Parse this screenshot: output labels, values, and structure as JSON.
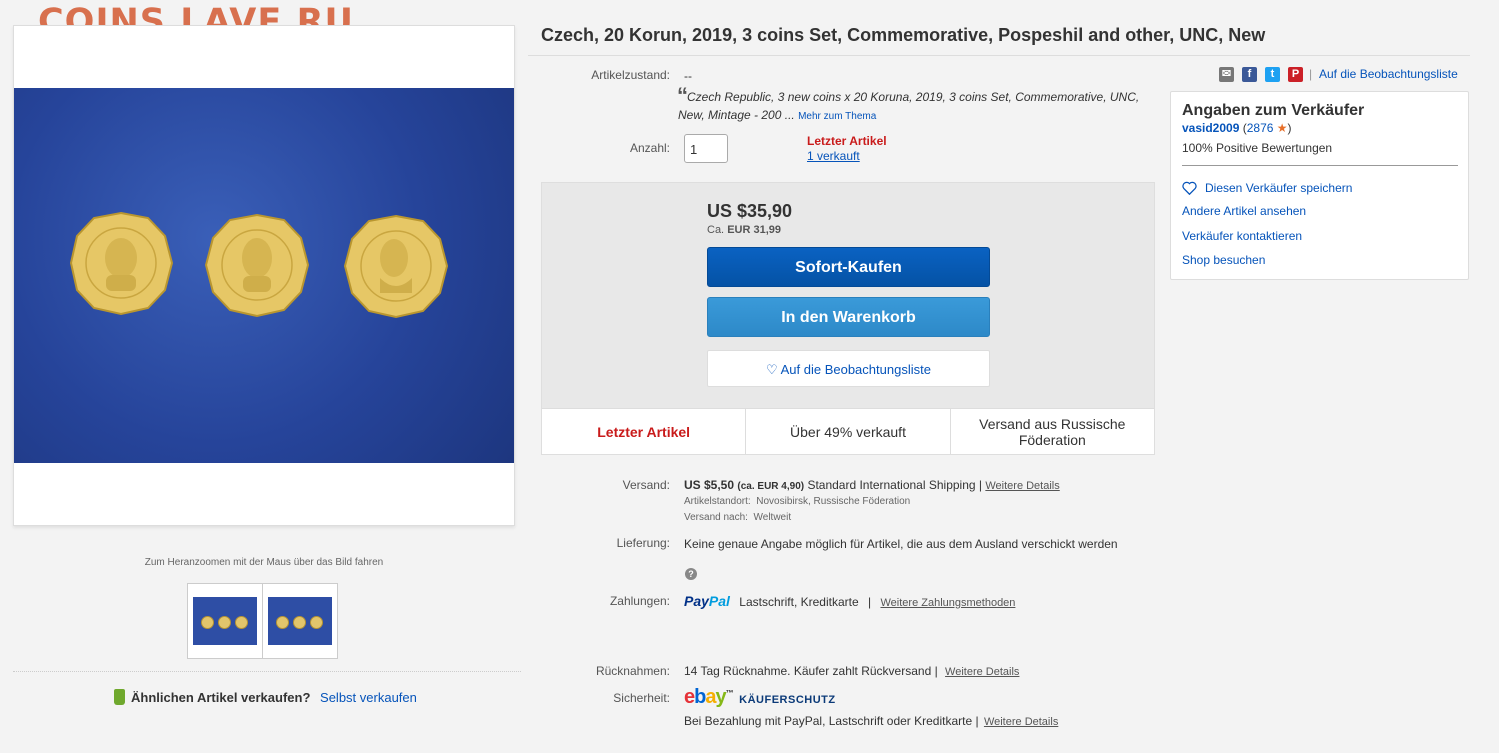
{
  "watermark": "COINS.LAVE.RU",
  "title": "Czech, 20 Korun, 2019, 3 coins Set, Commemorative, Pospeshil and other, UNC, New",
  "gallery": {
    "zoom_hint": "Zum Heranzoomen mit der Maus über das Bild fahren",
    "sell_similar_question": "Ähnlichen Artikel verkaufen?",
    "sell_similar_link": "Selbst verkaufen"
  },
  "condition": {
    "label": "Artikelzustand:",
    "value": "--",
    "quote_mark": "“",
    "description": "Czech Republic, 3 new coins x 20 Koruna, 2019, 3 coins Set, Commemorative, UNC, New, Mintage - 200",
    "ellipsis": "...",
    "more_link": "Mehr zum Thema"
  },
  "quantity": {
    "label": "Anzahl:",
    "value": "1",
    "last_item": "Letzter Artikel",
    "sold": "1 verkauft"
  },
  "buy": {
    "price": "US $35,90",
    "approx_prefix": "Ca.",
    "approx_value": "EUR 31,99",
    "buy_now": "Sofort-Kaufen",
    "add_to_cart": "In den Warenkorb",
    "watch_heart": "♡",
    "watch": "Auf die Beobachtungsliste",
    "stats": [
      "Letzter Artikel",
      "Über 49% verkauft",
      "Versand aus Russische Föderation"
    ]
  },
  "share": {
    "icons": [
      "email-icon",
      "facebook-icon",
      "twitter-icon",
      "pinterest-icon"
    ],
    "facebook_glyph": "f",
    "twitter_glyph": "t",
    "pinterest_glyph": "P",
    "separator": "|",
    "watch_link": "Auf die Beobachtungsliste"
  },
  "seller": {
    "heading": "Angaben zum Verkäufer",
    "name": "vasid2009",
    "score_open": "(",
    "score": "2876",
    "score_close": ")",
    "star": "★",
    "positive": "100% Positive Bewertungen",
    "save": "Diesen Verkäufer speichern",
    "other_items": "Andere Artikel ansehen",
    "contact": "Verkäufer kontaktieren",
    "shop": "Shop besuchen"
  },
  "shipping": {
    "label": "Versand:",
    "price": "US $5,50",
    "approx": "(ca. EUR 4,90)",
    "method": "Standard International Shipping |",
    "details": "Weitere Details",
    "location_label": "Artikelstandort:",
    "location": "Novosibirsk, Russische Föderation",
    "ships_to_label": "Versand nach:",
    "ships_to": "Weltweit"
  },
  "delivery": {
    "label": "Lieferung:",
    "text": "Keine genaue Angabe möglich für Artikel, die aus dem Ausland verschickt werden",
    "help": "?"
  },
  "payment": {
    "label": "Zahlungen:",
    "paypal_pay": "Pay",
    "paypal_pal": "Pal",
    "methods": "Lastschrift,  Kreditkarte",
    "separator": "|",
    "more": "Weitere Zahlungsmethoden"
  },
  "returns": {
    "label": "Rücknahmen:",
    "text": "14 Tag Rücknahme. Käufer zahlt Rückversand |",
    "details": "Weitere Details"
  },
  "security": {
    "label": "Sicherheit:",
    "ebay_letters": [
      "e",
      "b",
      "a",
      "y"
    ],
    "tm": "™",
    "protection": "KÄUFERSCHUTZ",
    "text": "Bei Bezahlung mit PayPal, Lastschrift oder Kreditkarte |",
    "details": "Weitere Details"
  },
  "colors": {
    "accent_link": "#0654ba",
    "buy_now": "#0654ba",
    "cart": "#3498db",
    "alert_red": "#c91b1b",
    "watermark": "#d8704e"
  }
}
